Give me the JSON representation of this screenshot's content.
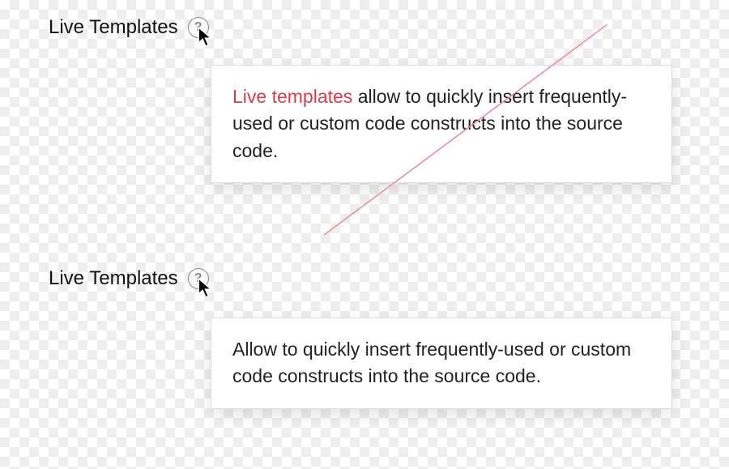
{
  "example1": {
    "title": "Live Templates",
    "help_glyph": "?",
    "tooltip_bad_prefix": "Live templates",
    "tooltip_rest": " allow to quickly insert frequently-used or custom code constructs into the source code."
  },
  "example2": {
    "title": "Live Templates",
    "help_glyph": "?",
    "tooltip_text": "Allow to quickly insert frequently-used or custom code constructs into the source code."
  }
}
